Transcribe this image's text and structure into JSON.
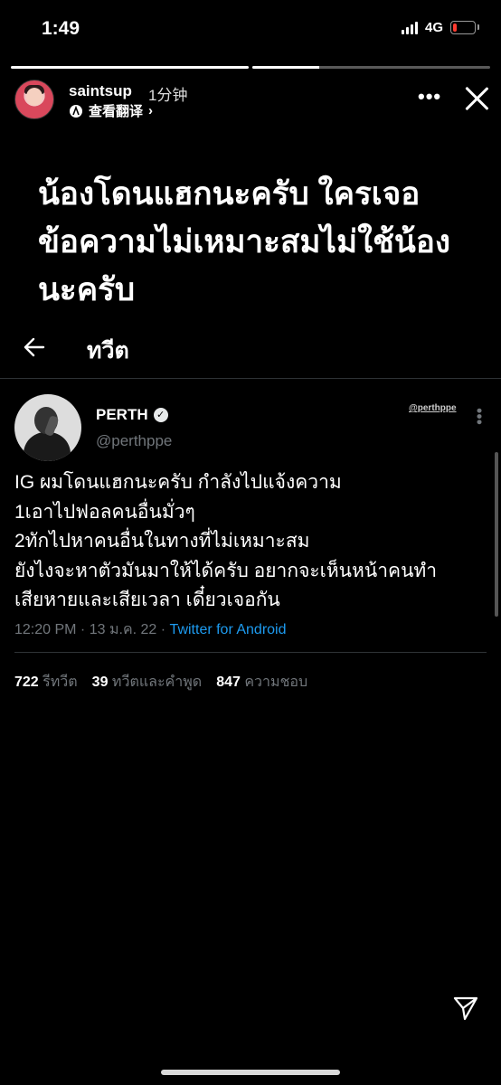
{
  "status_bar": {
    "time": "1:49",
    "network": "4G",
    "battery_level": 0.2,
    "battery_color": "#ff3b30"
  },
  "story": {
    "progress": [
      1.0,
      0.28
    ],
    "username": "saintsup",
    "time_ago": "1分钟",
    "translate_label": "查看翻译",
    "more_icon": "more-icon",
    "close_icon": "close-icon",
    "caption": "น้องโดนแฮกนะครับ ใครเจอข้อความไม่เหมาะสมไม่ใช้น้องนะครับ"
  },
  "tweet_header": {
    "back_icon": "back-arrow-icon",
    "title": "ทวีต"
  },
  "tweet": {
    "author_name": "PERTH",
    "author_handle": "@perthppe",
    "watermark": "@perthppe",
    "lines": [
      "IG ผมโดนแฮกนะครับ กำลังไปแจ้งความ",
      "1เอาไปฟอลคนอื่นมั่วๆ",
      "2ทักไปหาคนอื่นในทางที่ไม่เหมาะสม",
      "ยังไงจะหาตัวมันมาให้ได้ครับ อยากจะเห็นหน้าคนทำ",
      "เสียหายและเสียเวลา เดี๋ยวเจอกัน"
    ],
    "timestamp": "12:20 PM · 13 ม.ค. 22 · ",
    "source": "Twitter for Android",
    "stats": {
      "retweets": "722",
      "retweets_label": "รีทวีต",
      "quotes": "39",
      "quotes_label": "ทวีตและคำพูด",
      "likes": "847",
      "likes_label": "ความชอบ"
    }
  },
  "footer": {
    "send_icon": "send-icon"
  }
}
